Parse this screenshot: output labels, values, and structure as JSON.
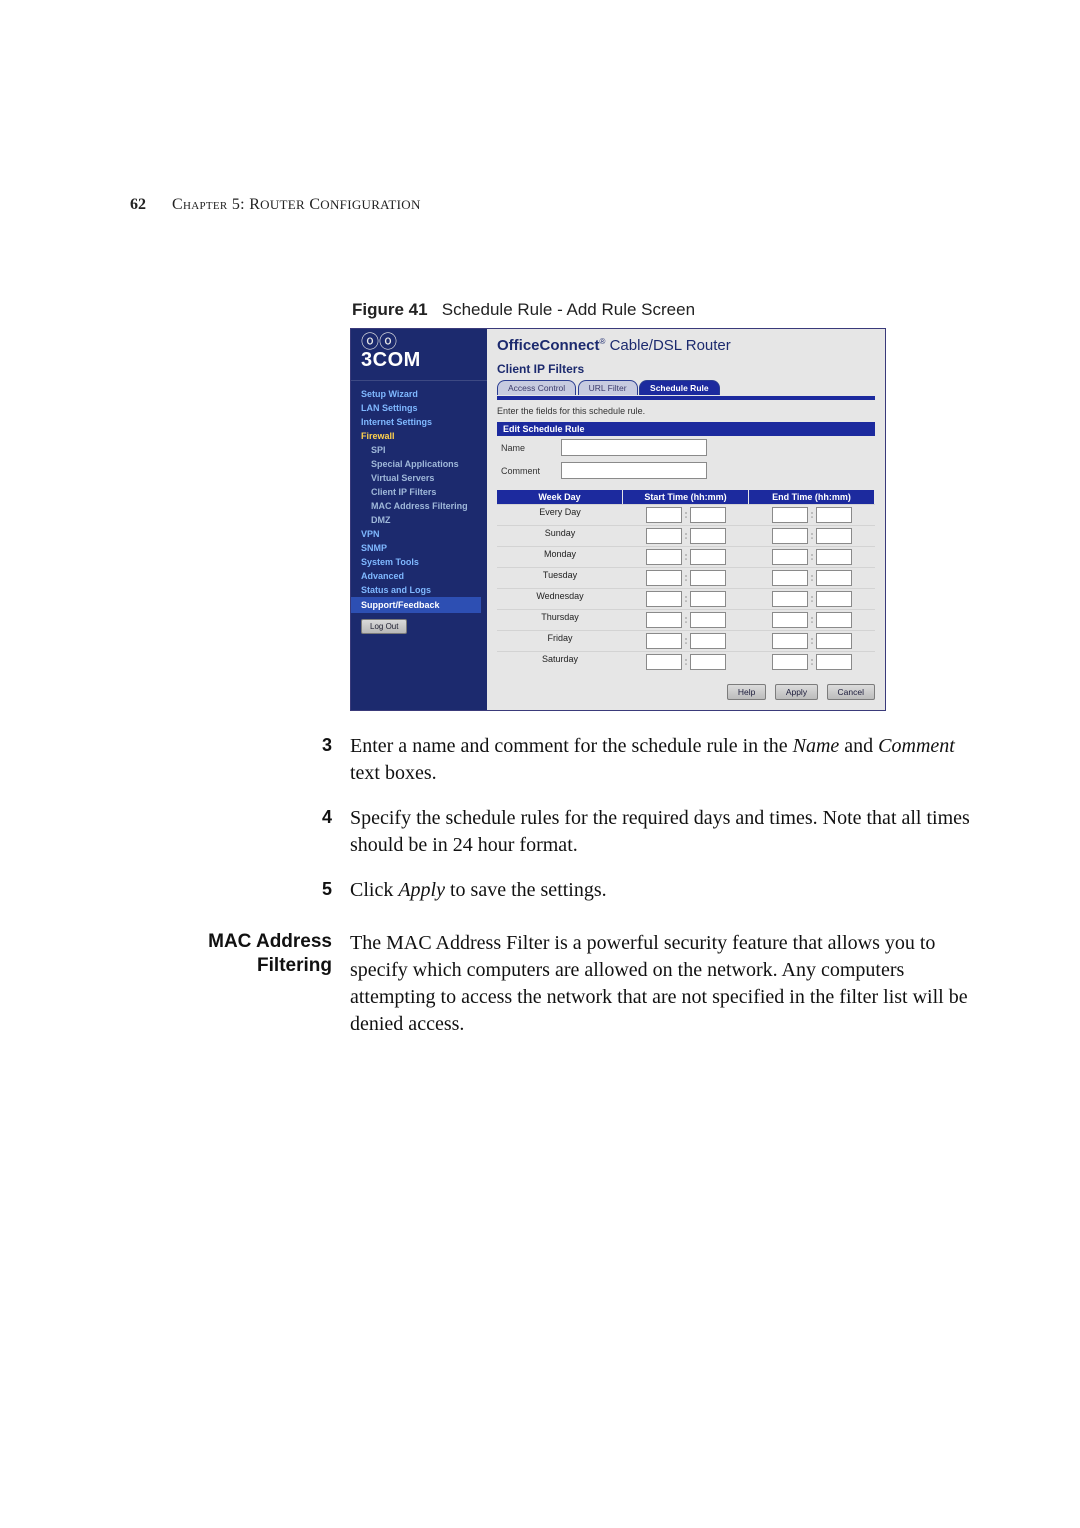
{
  "page_number": "62",
  "running_head_a": "Chapter 5: R",
  "running_head_b": "outer",
  "running_head_c": " C",
  "running_head_d": "onfiguration",
  "figure": {
    "label": "Figure 41",
    "caption": "Schedule Rule - Add Rule Screen"
  },
  "router": {
    "brand": "3COM",
    "title_bold": "OfficeConnect",
    "title_rest": " Cable/DSL Router",
    "section": "Client IP Filters",
    "tabs": {
      "t1": "Access Control",
      "t2": "URL Filter",
      "t3": "Schedule Rule"
    },
    "hint": "Enter the fields for this schedule rule.",
    "band": "Edit Schedule Rule",
    "form": {
      "name_label": "Name",
      "comment_label": "Comment"
    },
    "cols": {
      "c1": "Week Day",
      "c2": "Start Time (hh:mm)",
      "c3": "End Time (hh:mm)"
    },
    "days": [
      "Every Day",
      "Sunday",
      "Monday",
      "Tuesday",
      "Wednesday",
      "Thursday",
      "Friday",
      "Saturday"
    ],
    "nav": {
      "setup": "Setup Wizard",
      "lan": "LAN Settings",
      "inet": "Internet Settings",
      "fw": "Firewall",
      "spi": "SPI",
      "spapps": "Special Applications",
      "vserv": "Virtual Servers",
      "cip": "Client IP Filters",
      "mac": "MAC Address Filtering",
      "dmz": "DMZ",
      "vpn": "VPN",
      "snmp": "SNMP",
      "tools": "System Tools",
      "adv": "Advanced",
      "status": "Status and Logs",
      "support": "Support/Feedback",
      "logout": "Log Out"
    },
    "buttons": {
      "help": "Help",
      "apply": "Apply",
      "cancel": "Cancel"
    },
    "colon": ":"
  },
  "steps": {
    "s3a": "Enter a name and comment for the schedule rule in the ",
    "s3b": "Name",
    "s3c": " and ",
    "s3d": "Comment",
    "s3e": " text boxes.",
    "s4": "Specify the schedule rules for the required days and times. Note that all times should be in 24 hour format.",
    "s5a": "Click ",
    "s5b": "Apply",
    "s5c": " to save the settings."
  },
  "section": {
    "heading_line1": "MAC Address",
    "heading_line2": "Filtering",
    "body": "The MAC Address Filter is a powerful security feature that allows you to specify which computers are allowed on the network. Any computers attempting to access the network that are not specified in the filter list will be denied access."
  },
  "nums": {
    "n3": "3",
    "n4": "4",
    "n5": "5"
  }
}
